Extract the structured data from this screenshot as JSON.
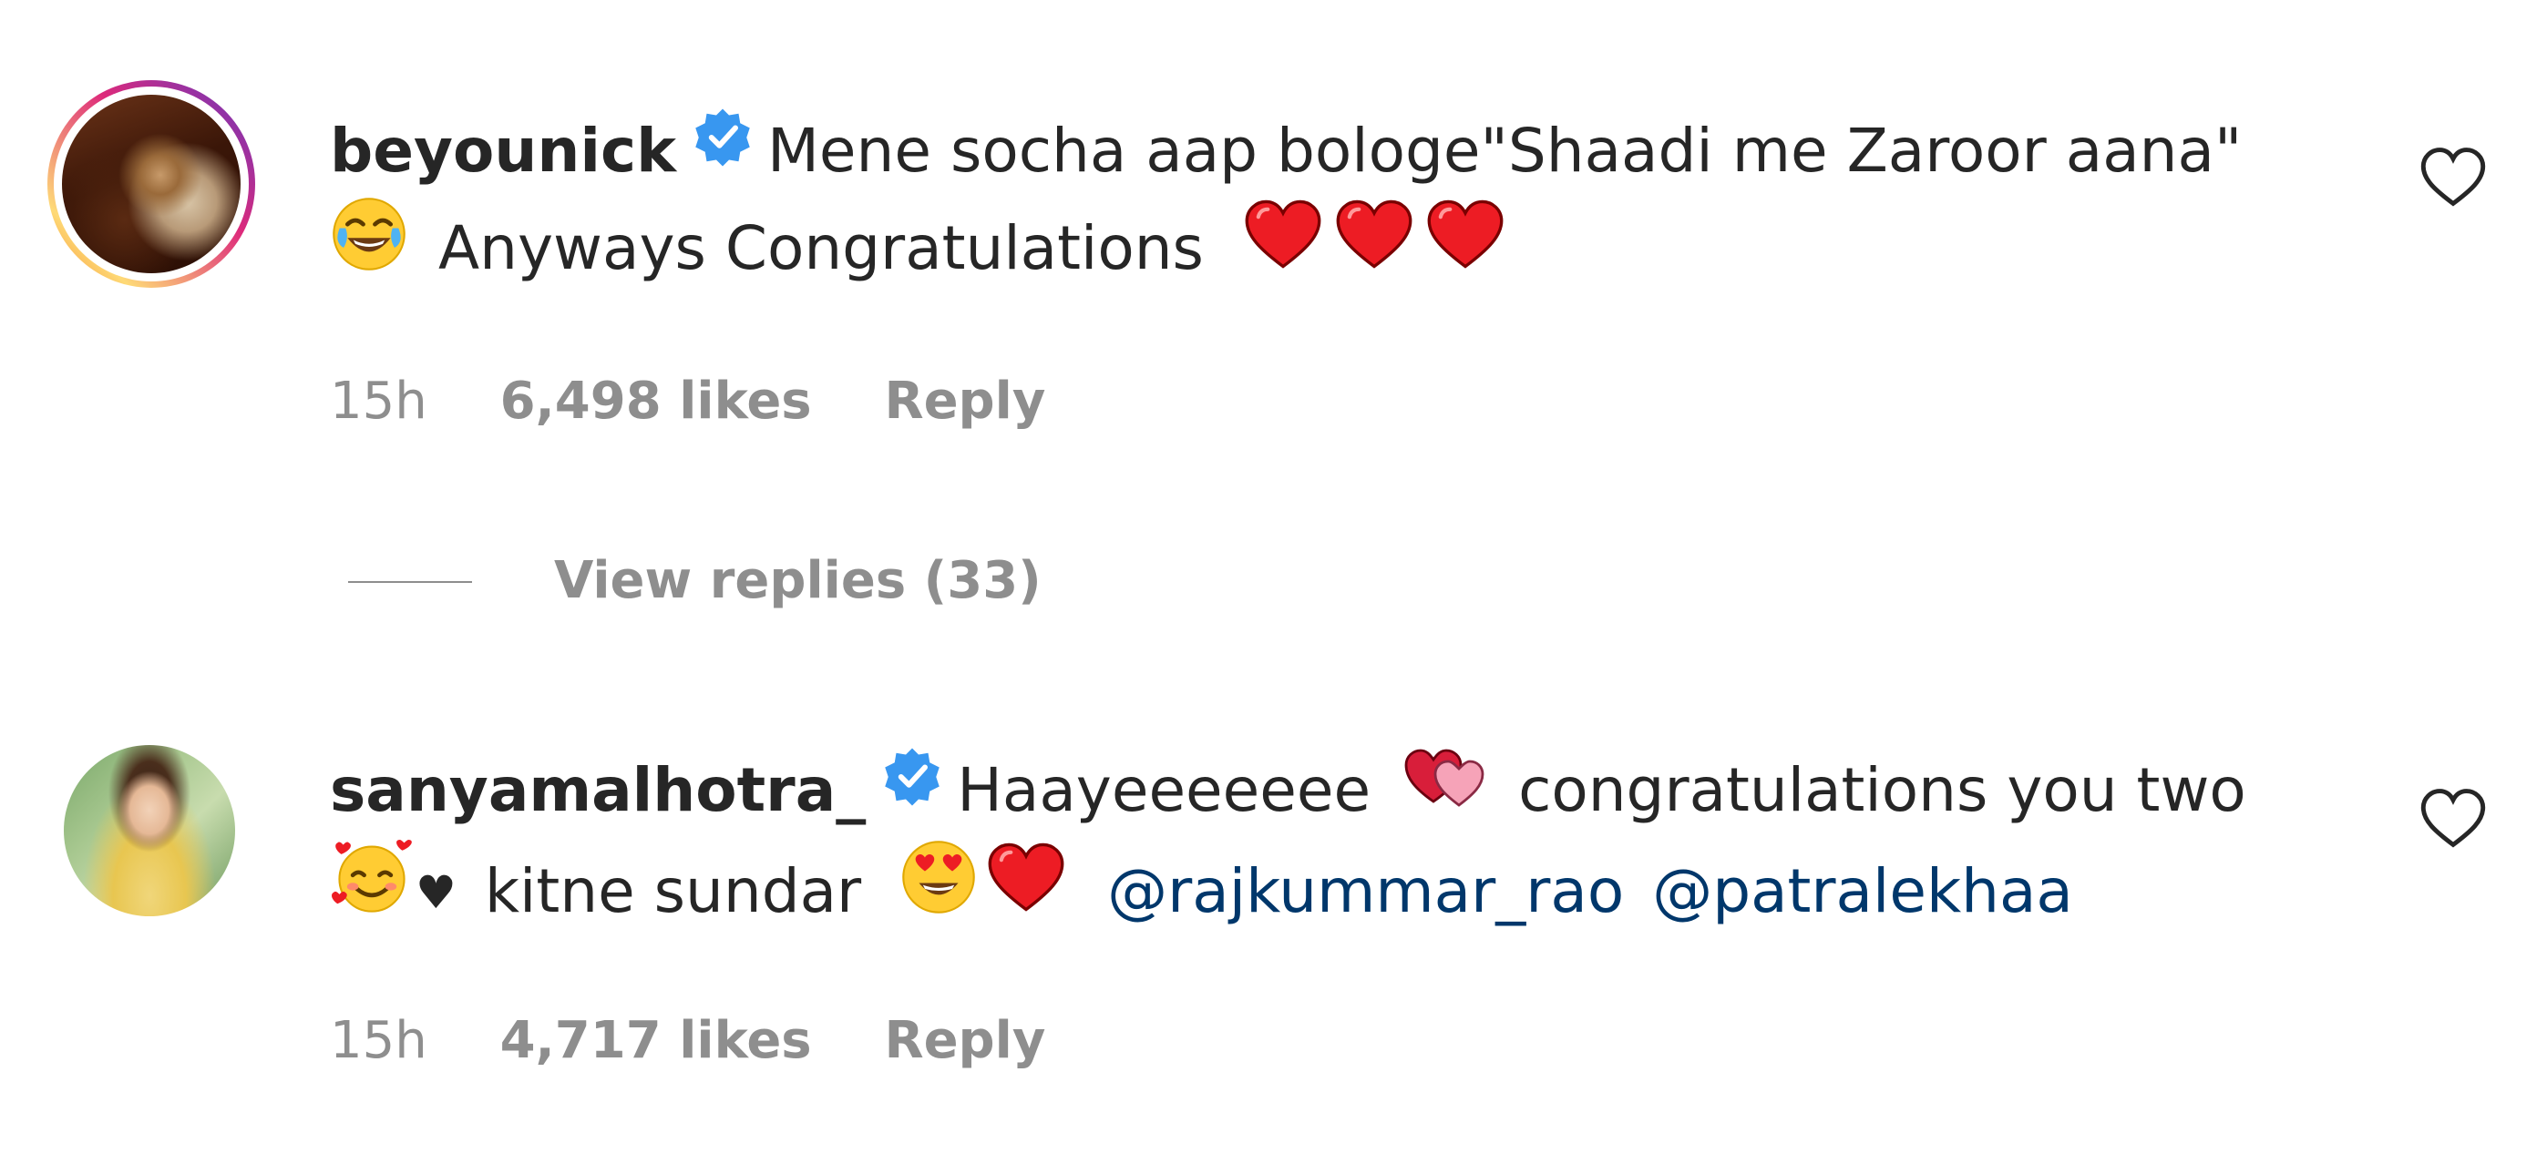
{
  "comments": [
    {
      "username": "beyounick",
      "verified": true,
      "line1": "Mene socha aap bologe\"Shaadi me Zaroor aana\"",
      "line2_text": "Anyways Congratulations",
      "emojis_line2_leading": "joy-emoji",
      "emojis_line2_trailing": [
        "red-heart-emoji",
        "red-heart-emoji",
        "red-heart-emoji"
      ],
      "time": "15h",
      "likes": "6,498 likes",
      "reply": "Reply",
      "view_replies": "View replies (33)"
    },
    {
      "username": "sanyamalhotra_",
      "verified": true,
      "line1_text_a": "Haayeeeeeee",
      "line1_text_b": "congratulations you two",
      "line2_text": "kitne sundar",
      "mention_1": "@rajkummar_rao",
      "mention_2": "@patralekhaa",
      "time": "15h",
      "likes": "4,717 likes",
      "reply": "Reply"
    }
  ],
  "colors": {
    "text": "#262626",
    "secondary": "#8e8e8e",
    "link": "#00376b",
    "verified": "#3897f0",
    "heart": "#ed1c24"
  }
}
